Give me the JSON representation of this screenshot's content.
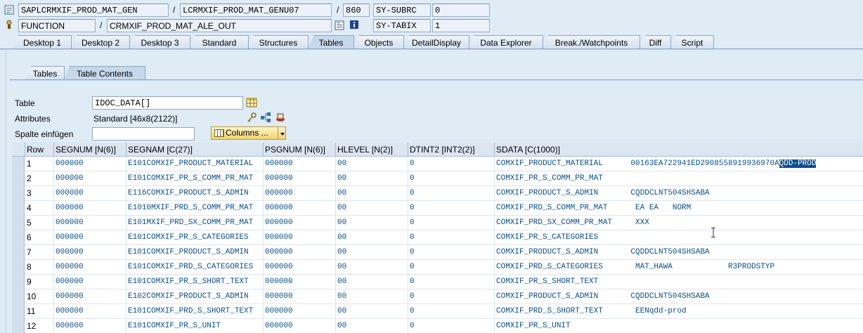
{
  "header": {
    "row1": {
      "program": "SAPLCRMXIF_PROD_MAT_GEN",
      "sep1": "/",
      "include": "LCRMXIF_PROD_MAT_GENU07",
      "sep2": "/",
      "line": "860",
      "sysfield_name": "SY-SUBRC",
      "sysfield_value": "0"
    },
    "row2": {
      "type": "FUNCTION",
      "sep": "/",
      "name": "CRMXIF_PROD_MAT_ALE_OUT",
      "sysfield_name": "SY-TABIX",
      "sysfield_value": "1"
    }
  },
  "tabs": [
    "Desktop 1",
    "Desktop 2",
    "Desktop 3",
    "Standard",
    "Structures",
    "Tables",
    "Objects",
    "DetailDisplay",
    "Data Explorer",
    "Break./Watchpoints",
    "Diff",
    "Script"
  ],
  "active_tab": "Tables",
  "inner_tabs": [
    "Tables",
    "Table Contents"
  ],
  "active_inner_tab": "Table Contents",
  "form": {
    "table_label": "Table",
    "table_value": "IDOC_DATA[]",
    "attributes_label": "Attributes",
    "attributes_value": "Standard [46x8(2122)]",
    "insert_col_label": "Spalte einfügen",
    "insert_col_value": "",
    "columns_button": "Columns ..."
  },
  "grid": {
    "columns": [
      "Row",
      "SEGNUM [N(6)]",
      "SEGNAM [C(27)]",
      "PSGNUM [N(6)]",
      "HLEVEL [N(2)]",
      "DTINT2 [INT2(2)]",
      "SDATA [C(1000)]"
    ],
    "rows": [
      {
        "row": "1",
        "segnum": "000000",
        "segnam": "E101COMXIF_PRODUCT_MATERIAL",
        "psgnum": "000000",
        "hlevel": "00",
        "dtint2": "0",
        "sdata": "COMXIF_PRODUCT_MATERIAL      00163EA722941ED2908558919936970A",
        "sdata_hl": "QDD-PROD"
      },
      {
        "row": "2",
        "segnum": "000000",
        "segnam": "E101COMXIF_PR_S_COMM_PR_MAT",
        "psgnum": "000000",
        "hlevel": "00",
        "dtint2": "0",
        "sdata": "COMXIF_PR_S_COMM_PR_MAT",
        "sdata_hl": ""
      },
      {
        "row": "3",
        "segnum": "000000",
        "segnam": "E116COMXIF_PRODUCT_S_ADMIN",
        "psgnum": "000000",
        "hlevel": "00",
        "dtint2": "0",
        "sdata": "COMXIF_PRODUCT_S_ADMIN       CQDDCLNT504SHSABA",
        "sdata_hl": ""
      },
      {
        "row": "4",
        "segnum": "000000",
        "segnam": "E1010MXIF_PRD_S_COMM_PR_MAT",
        "psgnum": "000000",
        "hlevel": "00",
        "dtint2": "0",
        "sdata": "COMXIF_PRD_S_COMM_PR_MAT      EA EA   NORM",
        "sdata_hl": ""
      },
      {
        "row": "5",
        "segnum": "000000",
        "segnam": "E101MXIF_PRD_SX_COMM_PR_MAT",
        "psgnum": "000000",
        "hlevel": "00",
        "dtint2": "0",
        "sdata": "COMXIF_PRD_SX_COMM_PR_MAT     XXX",
        "sdata_hl": ""
      },
      {
        "row": "6",
        "segnum": "000000",
        "segnam": "E101COMXIF_PR_S_CATEGORIES",
        "psgnum": "000000",
        "hlevel": "00",
        "dtint2": "0",
        "sdata": "COMXIF_PR_S_CATEGORIES",
        "sdata_hl": ""
      },
      {
        "row": "7",
        "segnum": "000000",
        "segnam": "E101COMXIF_PRODUCT_S_ADMIN",
        "psgnum": "000000",
        "hlevel": "00",
        "dtint2": "0",
        "sdata": "COMXIF_PRODUCT_S_ADMIN       CQDDCLNT504SHSABA",
        "sdata_hl": ""
      },
      {
        "row": "8",
        "segnum": "000000",
        "segnam": "E101COMXIF_PRD_S_CATEGORIES",
        "psgnum": "000000",
        "hlevel": "00",
        "dtint2": "0",
        "sdata": "COMXIF_PRD_S_CATEGORIES       MAT_HAWA            R3PRODSTYP",
        "sdata_hl": ""
      },
      {
        "row": "9",
        "segnum": "000000",
        "segnam": "E101COMXIF_PR_S_SHORT_TEXT",
        "psgnum": "000000",
        "hlevel": "00",
        "dtint2": "0",
        "sdata": "COMXIF_PR_S_SHORT_TEXT",
        "sdata_hl": ""
      },
      {
        "row": "10",
        "segnum": "000000",
        "segnam": "E102COMXIF_PRODUCT_S_ADMIN",
        "psgnum": "000000",
        "hlevel": "00",
        "dtint2": "0",
        "sdata": "COMXIF_PRODUCT_S_ADMIN       CQDDCLNT504SHSABA",
        "sdata_hl": ""
      },
      {
        "row": "11",
        "segnum": "000000",
        "segnam": "E101COMXIF_PRD_S_SHORT_TEXT",
        "psgnum": "000000",
        "hlevel": "00",
        "dtint2": "0",
        "sdata": "COMXIF_PRD_S_SHORT_TEXT       EENqdd-prod",
        "sdata_hl": ""
      },
      {
        "row": "12",
        "segnum": "000000",
        "segnam": "E101COMXIF_PR_S_UNIT",
        "psgnum": "000000",
        "hlevel": "00",
        "dtint2": "0",
        "sdata": "COMXIF_PR_S_UNIT",
        "sdata_hl": ""
      }
    ]
  },
  "colors": {
    "background": "#dfebf5",
    "cell_text": "#0a4f8e",
    "highlight": "#0a4f8e"
  }
}
